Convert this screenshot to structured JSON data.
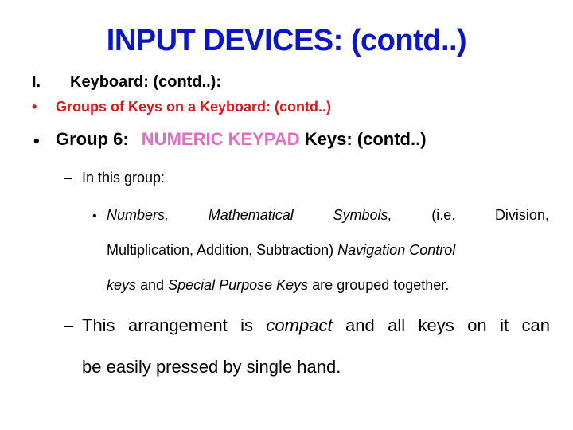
{
  "slide": {
    "title": "INPUT DEVICES: (contd..)",
    "colors": {
      "title": "#0a16c8",
      "subheading": "#d41a1a",
      "highlight": "#e26bc4",
      "text": "#000000"
    },
    "section": {
      "number": "I.",
      "label": "Keyboard: (contd..):"
    },
    "subheading": {
      "bullet": "•",
      "text": "Groups of Keys on a Keyboard: (contd..)"
    },
    "group": {
      "bullet": "•",
      "prefix": "Group 6:",
      "highlight": "NUMERIC KEYPAD",
      "suffix": "Keys: (contd..)"
    },
    "point1": {
      "dash": "–",
      "text": "In this group:"
    },
    "detail": {
      "bullet": "•",
      "line1": {
        "w1": "Numbers,",
        "w2": "Mathematical",
        "w3": "Symbols,",
        "w4": "(i.e.",
        "w5": "Division,"
      },
      "line2": {
        "normal": "Multiplication, Addition, Subtraction) ",
        "italic": "Navigation Control"
      },
      "line3": {
        "italic1": "keys",
        "normal1": " and ",
        "italic2": "Special Purpose Keys",
        "normal2": " are grouped together."
      }
    },
    "point2": {
      "dash": "–",
      "w1": "This",
      "w2": "arrangement",
      "w3": "is",
      "w4": "compact",
      "w5": "and",
      "w6": "all",
      "w7": "keys",
      "w8": "on",
      "w9": "it",
      "w10": "can",
      "line2": "be easily pressed by single hand."
    }
  }
}
